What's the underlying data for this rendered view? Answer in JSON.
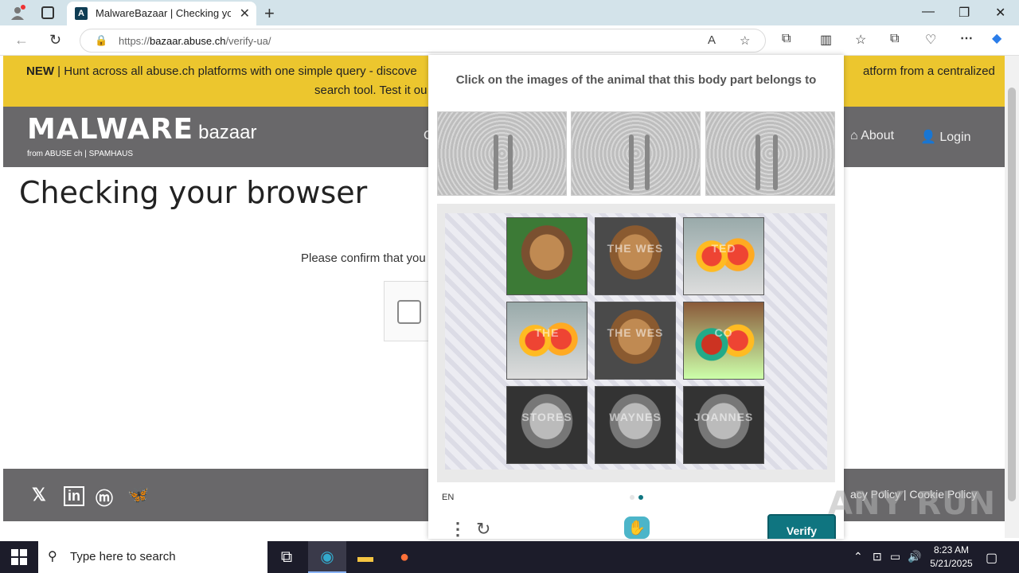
{
  "browser": {
    "tab_title": "MalwareBazaar | Checking your b",
    "url_prefix": "https://",
    "url_domain": "bazaar.abuse.ch",
    "url_path": "/verify-ua/"
  },
  "page": {
    "banner_new": "NEW",
    "banner_line1_left": " | Hunt across all abuse.ch platforms with one simple query - discove",
    "banner_line1_right": "atform from a centralized",
    "banner_line2_left": "search tool. Test it ou",
    "logo_big": "MALWARE",
    "logo_small": "bazaar",
    "logo_from": "from ABUSE ch | SPAMHAUS",
    "nav_about": "About",
    "nav_login": "Login",
    "nav_partial": "C",
    "heading": "Checking your browser",
    "confirm_text": "Please confirm that you",
    "footer_links_partial": "acy Policy  |  Cookie Policy"
  },
  "captcha": {
    "prompt": "Click on the images of the animal that this body part belongs to",
    "language": "EN",
    "verify_label": "Verify",
    "grid": [
      {
        "animal": "camel",
        "watermark": ""
      },
      {
        "animal": "camel",
        "watermark": "THE WES"
      },
      {
        "animal": "parrot",
        "watermark": "TED"
      },
      {
        "animal": "parrot",
        "watermark": "THE"
      },
      {
        "animal": "camel",
        "watermark": "THE WES"
      },
      {
        "animal": "parrot",
        "watermark": "CO"
      },
      {
        "animal": "camel",
        "watermark": "STORES"
      },
      {
        "animal": "camel",
        "watermark": "WAYNES"
      },
      {
        "animal": "camel",
        "watermark": "JOANNES"
      }
    ]
  },
  "watermark": "ANY RUN",
  "taskbar": {
    "search_placeholder": "Type here to search",
    "time": "8:23 AM",
    "date": "5/21/2025"
  },
  "colors": {
    "banner": "#ecc62e",
    "header": "#69686a",
    "verify": "#0f7580"
  }
}
